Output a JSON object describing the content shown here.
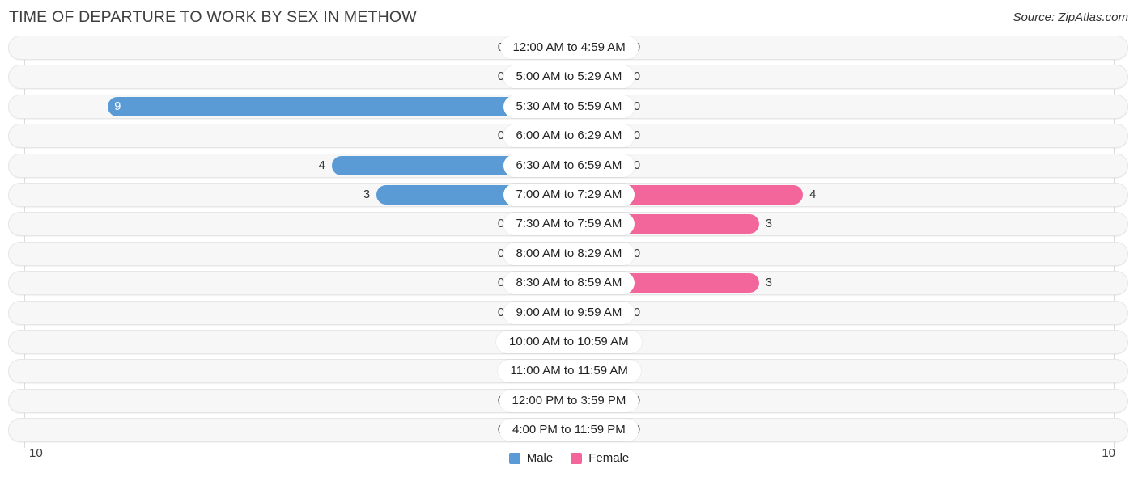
{
  "header": {
    "title": "TIME OF DEPARTURE TO WORK BY SEX IN METHOW",
    "source": "Source: ZipAtlas.com"
  },
  "axis": {
    "left_label": "10",
    "right_label": "10"
  },
  "legend": {
    "items": [
      {
        "label": "Male",
        "color": "#5a9bd5",
        "icon": "male-color-swatch"
      },
      {
        "label": "Female",
        "color": "#f2669b",
        "icon": "female-color-swatch"
      }
    ]
  },
  "colors": {
    "male_solid": "#5a9bd5",
    "male_light": "#a8c8ec",
    "female_solid": "#f2669b",
    "female_light": "#f7a8c4",
    "track": "#f7f7f7",
    "gridline": "#dcdcdc",
    "title": "#3f3f3f"
  },
  "chart_data": {
    "type": "bar",
    "subtype": "diverging-bidirectional-bar",
    "title": "TIME OF DEPARTURE TO WORK BY SEX IN METHOW",
    "xlabel": "",
    "ylabel": "",
    "xlim": [
      10,
      10
    ],
    "axis_max_per_side": 10,
    "grid": true,
    "legend_position": "bottom-center",
    "categories": [
      "12:00 AM to 4:59 AM",
      "5:00 AM to 5:29 AM",
      "5:30 AM to 5:59 AM",
      "6:00 AM to 6:29 AM",
      "6:30 AM to 6:59 AM",
      "7:00 AM to 7:29 AM",
      "7:30 AM to 7:59 AM",
      "8:00 AM to 8:29 AM",
      "8:30 AM to 8:59 AM",
      "9:00 AM to 9:59 AM",
      "10:00 AM to 10:59 AM",
      "11:00 AM to 11:59 AM",
      "12:00 PM to 3:59 PM",
      "4:00 PM to 11:59 PM"
    ],
    "series": [
      {
        "name": "Male",
        "direction": "left",
        "values": [
          0,
          0,
          9,
          0,
          4,
          3,
          0,
          0,
          0,
          0,
          0,
          0,
          0,
          0
        ]
      },
      {
        "name": "Female",
        "direction": "right",
        "values": [
          0,
          0,
          0,
          0,
          0,
          4,
          3,
          0,
          3,
          0,
          0,
          0,
          0,
          0
        ]
      }
    ]
  }
}
